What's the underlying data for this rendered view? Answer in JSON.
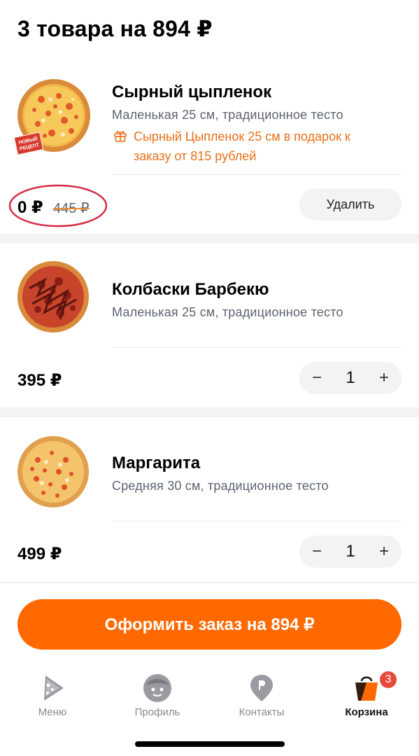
{
  "header": {
    "title": "3 товара на 894 ₽"
  },
  "items": [
    {
      "name": "Сырный цыпленок",
      "desc": "Маленькая 25 см, традиционное тесто",
      "gift_line1": "Сырный Цыпленок 25 см в подарок к",
      "gift_line2": "заказу от 815 рублей",
      "badge_line1": "НОВЫЙ",
      "badge_line2": "РЕЦЕПТ",
      "price": "0 ₽",
      "old_price": "445 ₽",
      "action_label": "Удалить"
    },
    {
      "name": "Колбаски Барбекю",
      "desc": "Маленькая 25 см, традиционное тесто",
      "price": "395 ₽",
      "qty": "1"
    },
    {
      "name": "Маргарита",
      "desc": "Средняя 30 см, традиционное тесто",
      "price": "499 ₽",
      "qty": "1"
    }
  ],
  "stepper": {
    "minus": "−",
    "plus": "+"
  },
  "checkout": {
    "label": "Оформить заказ на 894 ₽"
  },
  "tabs": [
    {
      "label": "Меню",
      "icon": "pizza-slice-icon"
    },
    {
      "label": "Профиль",
      "icon": "profile-face-icon"
    },
    {
      "label": "Контакты",
      "icon": "map-pin-icon"
    },
    {
      "label": "Корзина",
      "icon": "shopping-bag-icon",
      "badge": "3",
      "active": true
    }
  ],
  "colors": {
    "accent": "#ff6900",
    "gift_text": "#e8701a",
    "highlight_ring": "#d62a45",
    "badge": "#e64a3c"
  }
}
